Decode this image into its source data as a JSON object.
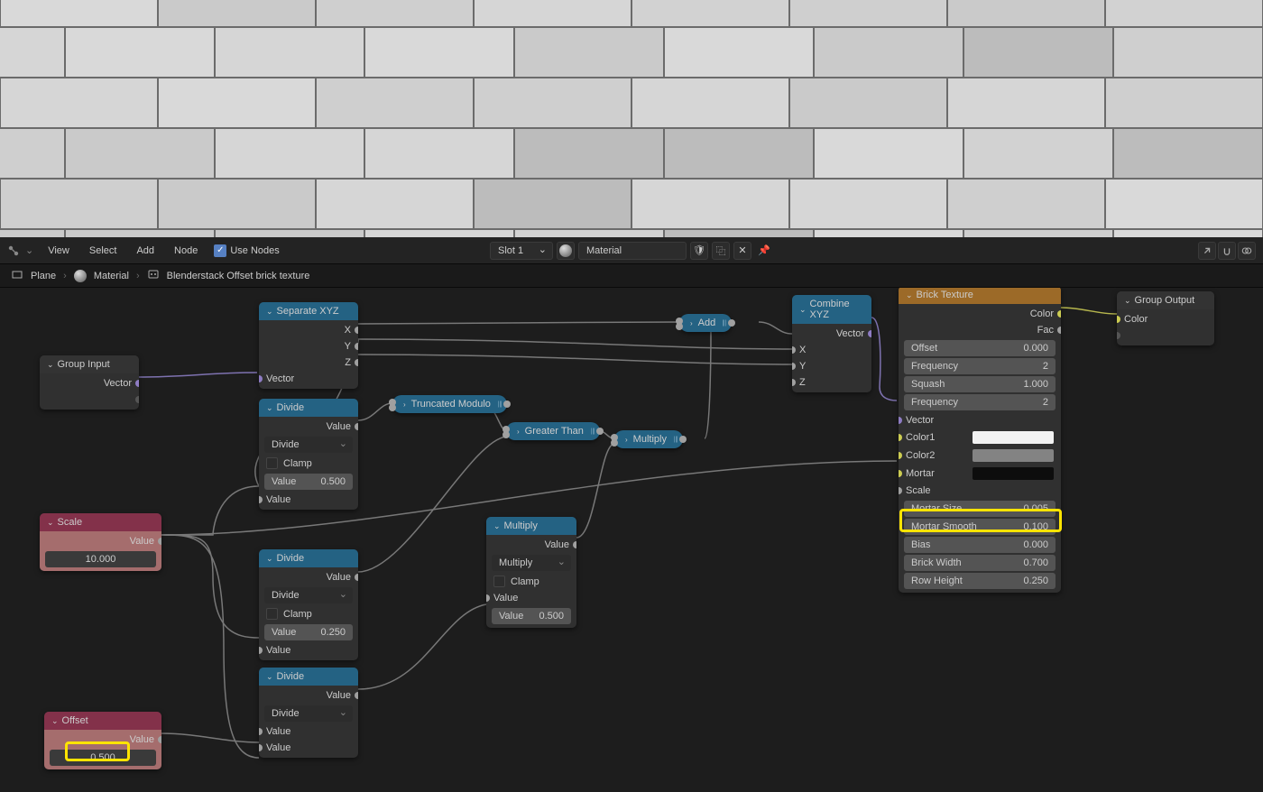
{
  "menubar": {
    "view": "View",
    "select": "Select",
    "add": "Add",
    "node": "Node",
    "use_nodes": "Use Nodes",
    "slot": "Slot 1",
    "material": "Material"
  },
  "breadcrumb": {
    "plane": "Plane",
    "material": "Material",
    "group": "Blenderstack Offset brick texture"
  },
  "nodes": {
    "group_input": {
      "title": "Group Input",
      "out_vector": "Vector"
    },
    "separate": {
      "title": "Separate XYZ",
      "x": "X",
      "y": "Y",
      "z": "Z",
      "in_vector": "Vector"
    },
    "scale": {
      "title": "Scale",
      "out_value": "Value",
      "num": "10.000"
    },
    "offset": {
      "title": "Offset",
      "out_value": "Value",
      "num": "0.500"
    },
    "divide1": {
      "title": "Divide",
      "out_value": "Value",
      "op": "Divide",
      "clamp": "Clamp",
      "val_label": "Value",
      "val_num": "0.500",
      "in_value": "Value"
    },
    "divide2": {
      "title": "Divide",
      "out_value": "Value",
      "op": "Divide",
      "clamp": "Clamp",
      "val_label": "Value",
      "val_num": "0.250",
      "in_value": "Value"
    },
    "divide3": {
      "title": "Divide",
      "out_value": "Value",
      "op": "Divide",
      "in_value1": "Value",
      "in_value2": "Value"
    },
    "truncmod": {
      "title": "Truncated Modulo"
    },
    "greater": {
      "title": "Greater Than"
    },
    "multiply_mini": {
      "title": "Multiply"
    },
    "add_mini": {
      "title": "Add"
    },
    "multiply": {
      "title": "Multiply",
      "out_value": "Value",
      "op": "Multiply",
      "clamp": "Clamp",
      "in_value": "Value",
      "val_label": "Value",
      "val_num": "0.500"
    },
    "combine": {
      "title": "Combine XYZ",
      "out_vector": "Vector",
      "x": "X",
      "y": "Y",
      "z": "Z"
    },
    "brick": {
      "title": "Brick Texture",
      "out_color": "Color",
      "out_fac": "Fac",
      "offset_l": "Offset",
      "offset_v": "0.000",
      "freq1_l": "Frequency",
      "freq1_v": "2",
      "squash_l": "Squash",
      "squash_v": "1.000",
      "freq2_l": "Frequency",
      "freq2_v": "2",
      "vector": "Vector",
      "color1": "Color1",
      "color2": "Color2",
      "mortar": "Mortar",
      "scale": "Scale",
      "msize_l": "Mortar Size",
      "msize_v": "0.005",
      "msmooth_l": "Mortar Smooth",
      "msmooth_v": "0.100",
      "bias_l": "Bias",
      "bias_v": "0.000",
      "bwidth_l": "Brick Width",
      "bwidth_v": "0.700",
      "rheight_l": "Row Height",
      "rheight_v": "0.250"
    },
    "group_output": {
      "title": "Group Output",
      "in_color": "Color"
    }
  }
}
